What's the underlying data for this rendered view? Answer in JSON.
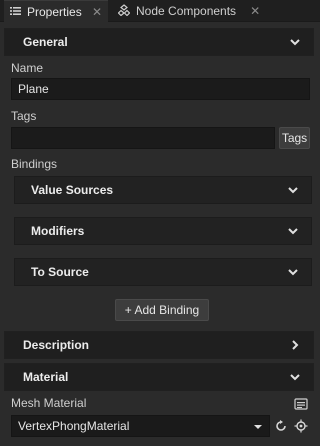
{
  "tabs": [
    {
      "label": "Properties",
      "icon": "list-icon"
    },
    {
      "label": "Node Components",
      "icon": "components-icon"
    }
  ],
  "general": {
    "header": "General",
    "name_label": "Name",
    "name_value": "Plane",
    "tags_label": "Tags",
    "tags_value": "",
    "tags_button": "Tags",
    "bindings_label": "Bindings",
    "binding_sections": [
      "Value Sources",
      "Modifiers",
      "To Source"
    ],
    "add_binding": "+ Add Binding"
  },
  "description": {
    "header": "Description"
  },
  "material": {
    "header": "Material",
    "mesh_label": "Mesh Material",
    "mesh_value": "VertexPhongMaterial"
  },
  "colors": {
    "background": "#2b2b2b",
    "header": "#1f1f1f",
    "input": "#1b1b1b",
    "text": "#d6d6d6"
  }
}
